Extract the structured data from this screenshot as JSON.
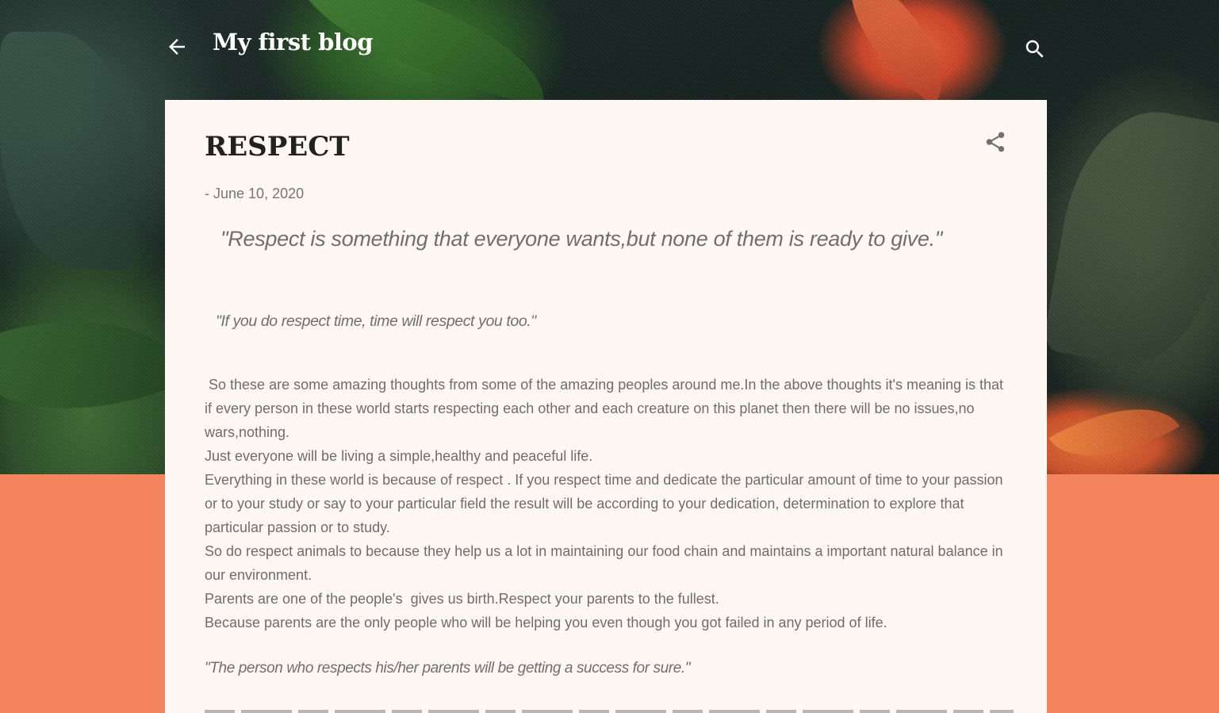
{
  "header": {
    "blog_title": "My first blog",
    "back_icon": "arrow-back-icon",
    "search_icon": "search-icon"
  },
  "post": {
    "title": "RESPECT",
    "date_prefix": "-",
    "date": "June 10, 2020",
    "share_icon": "share-icon",
    "quote_1": "\"Respect is something that everyone wants,but none of them is ready to give.\"",
    "quote_2": "\"If you do respect time, time will respect you too.\"",
    "paragraphs": [
      " So these are some amazing thoughts from some of the amazing peoples around me.In the above thoughts it's meaning is that if every person in these world starts respecting each other and each creature on this planet then there will be no issues,no wars,nothing.",
      "Just everyone will be living a simple,healthy and peaceful life.",
      "Everything in these world is because of respect . If you respect time and dedicate the particular amount of time to your passion or to your study or say to your particular field the result will be according to your dedication, determination to explore that particular passion or to study.",
      "So do respect animals to because they help us a lot in maintaining our food chain and maintains a important natural balance in our environment.",
      "Parents are one of the people's  gives us birth.Respect your parents to the fullest.",
      "Because parents are the only people who will be helping you even though you got failed in any period of life."
    ],
    "quote_3": "\"The person who respects his/her parents will be getting a success for sure.\""
  },
  "colors": {
    "accent_orange": "#f3845d",
    "card_background": "#fff7f4",
    "title_text": "#212121",
    "body_text": "#6d6d6d"
  }
}
